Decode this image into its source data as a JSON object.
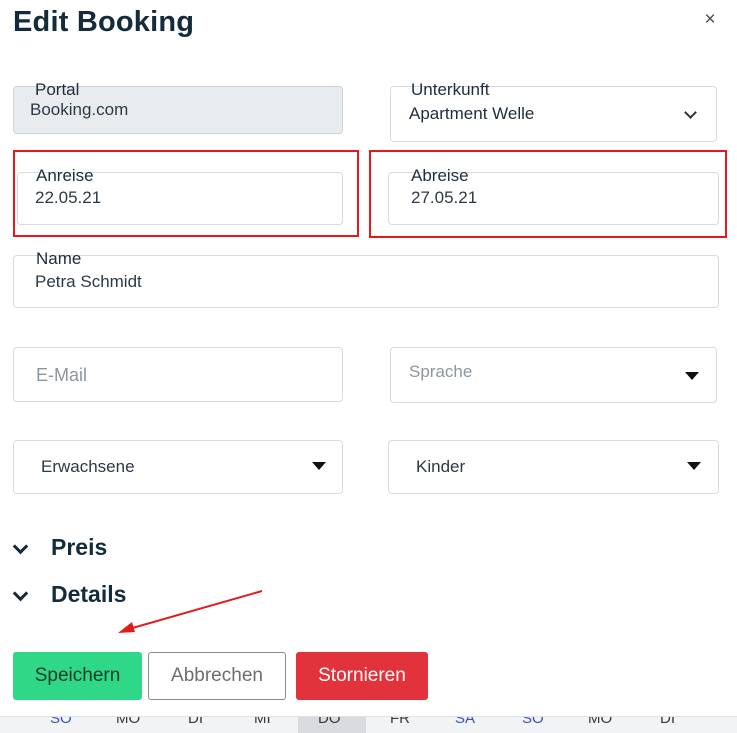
{
  "dialog": {
    "title": "Edit Booking",
    "close_glyph": "×"
  },
  "fields": {
    "portal": {
      "label": "Portal",
      "value": "Booking.com"
    },
    "unterkunft": {
      "label": "Unterkunft",
      "value": "Apartment Welle"
    },
    "anreise": {
      "label": "Anreise",
      "value": "22.05.21"
    },
    "abreise": {
      "label": "Abreise",
      "value": "27.05.21"
    },
    "name": {
      "label": "Name",
      "value": "Petra Schmidt"
    },
    "email": {
      "placeholder": "E-Mail",
      "value": ""
    },
    "sprache": {
      "placeholder": "Sprache"
    },
    "erwachsene": {
      "value": "Erwachsene"
    },
    "kinder": {
      "value": "Kinder"
    }
  },
  "sections": [
    {
      "label": "Preis"
    },
    {
      "label": "Details"
    }
  ],
  "buttons": {
    "save": "Speichern",
    "cancel": "Abbrechen",
    "storno": "Stornieren"
  },
  "annotations": {
    "highlight_color": "#e31b1b"
  },
  "colors": {
    "save": "#2ed886",
    "storno": "#e2333c",
    "title": "#132b3a"
  },
  "calendar_strip": [
    "",
    "SO",
    "MO",
    "DI",
    "MI",
    "DO",
    "FR",
    "SA",
    "SO",
    "MO",
    "DI",
    ""
  ]
}
